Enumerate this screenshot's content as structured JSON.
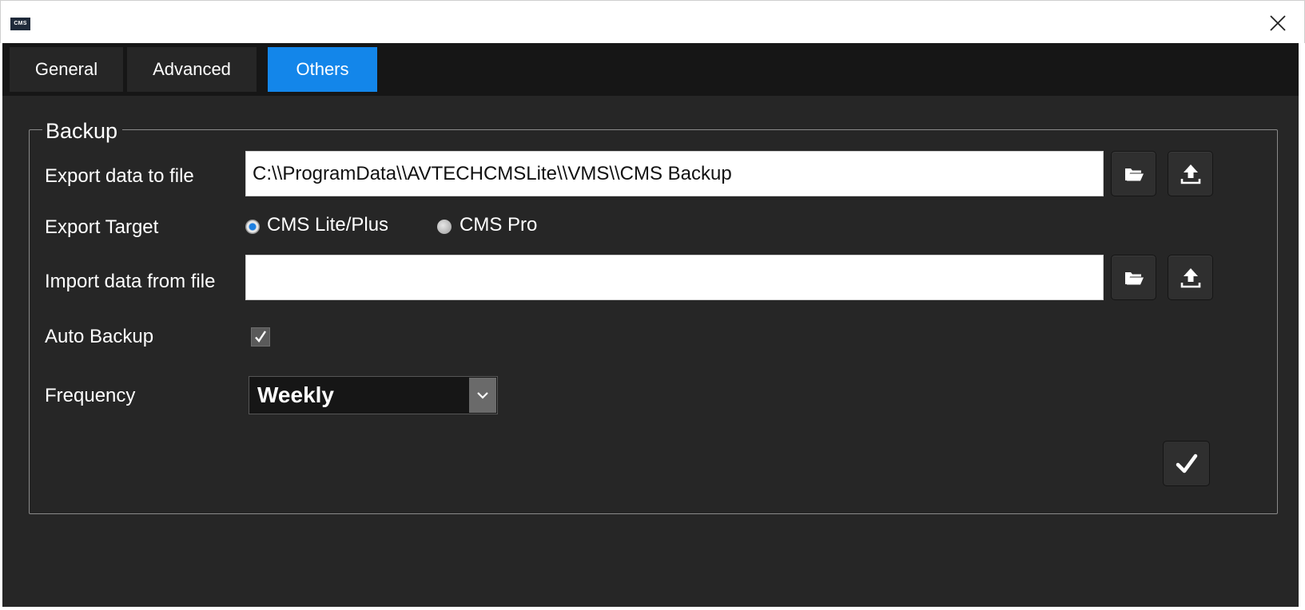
{
  "window": {
    "logo_text": "CMS",
    "close_glyph": "×"
  },
  "tabs": [
    {
      "label": "General",
      "active": false
    },
    {
      "label": "Advanced",
      "active": false
    },
    {
      "label": "Others",
      "active": true
    }
  ],
  "backup": {
    "title": "Backup",
    "export_label": "Export data to file",
    "export_path": "C:\\\\ProgramData\\\\AVTECHCMSLite\\\\VMS\\\\CMS Backup",
    "export_target_label": "Export Target",
    "target_options": [
      {
        "label": "CMS Lite/Plus",
        "selected": true
      },
      {
        "label": "CMS Pro",
        "selected": false
      }
    ],
    "import_label": "Import data from file",
    "import_path": "",
    "auto_backup_label": "Auto Backup",
    "auto_backup_checked": true,
    "frequency_label": "Frequency",
    "frequency_value": "Weekly"
  },
  "icons": {
    "folder": "folder-open-icon",
    "upload": "upload-icon",
    "close": "close-icon",
    "confirm": "checkmark-icon",
    "dropdown": "chevron-down-icon"
  },
  "colors": {
    "accent": "#1386ea",
    "panel": "#262626",
    "tabbar": "#161616"
  }
}
